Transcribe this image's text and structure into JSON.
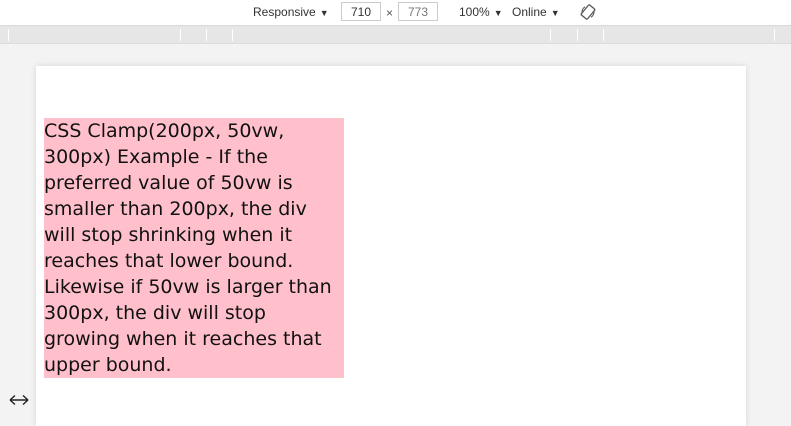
{
  "toolbar": {
    "device_label": "Responsive",
    "width_value": "710",
    "dimension_separator": "×",
    "height_value": "773",
    "zoom_label": "100%",
    "throttle_label": "Online",
    "caret": "▼"
  },
  "content": {
    "clamp_text": "CSS Clamp(200px, 50vw, 300px) Example - If the preferred value of 50vw is smaller than 200px, the div will stop shrinking when it reaches that lower bound. Likewise if 50vw is larger than 300px, the div will stop growing when it reaches that upper bound.",
    "background_color": "#ffc0cb"
  },
  "icons": {
    "rotate": "rotate-icon",
    "resize_handle": "horizontal-resize-icon"
  }
}
